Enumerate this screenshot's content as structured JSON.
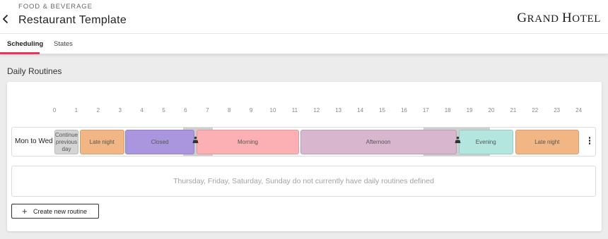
{
  "header": {
    "category": "FOOD & BEVERAGE",
    "title": "Restaurant Template",
    "logo_text": "GRAND HOTEL",
    "logo_parts": [
      "G",
      "RAND ",
      "H",
      "OTEL"
    ]
  },
  "tabs": [
    {
      "label": "Scheduling",
      "active": true
    },
    {
      "label": "States",
      "active": false
    }
  ],
  "section": {
    "title": "Daily Routines"
  },
  "timeline": {
    "hours": [
      "0",
      "1",
      "2",
      "3",
      "4",
      "5",
      "6",
      "7",
      "8",
      "9",
      "10",
      "11",
      "12",
      "13",
      "14",
      "15",
      "16",
      "17",
      "18",
      "19",
      "20",
      "21",
      "22",
      "23",
      "24"
    ]
  },
  "routine": {
    "label": "Mon to Wed",
    "segments": [
      {
        "label": "Continue previous day",
        "start": 0,
        "end": 1.1,
        "color": "#d4d4d4"
      },
      {
        "label": "Late night",
        "start": 1.15,
        "end": 3.2,
        "color": "#f1b683"
      },
      {
        "label": "Closed",
        "start": 3.25,
        "end": 6.4,
        "color": "#a996de"
      },
      {
        "label": "Morning",
        "start": 6.5,
        "end": 11.2,
        "color": "#fcb0b3"
      },
      {
        "label": "Afternoon",
        "start": 11.25,
        "end": 18.4,
        "color": "#d7b6ce"
      },
      {
        "label": "Evening",
        "start": 18.5,
        "end": 21.0,
        "color": "#b3e6df"
      },
      {
        "label": "Late night",
        "start": 21.1,
        "end": 24.0,
        "color": "#f1b683"
      }
    ],
    "transitions": [
      {
        "start": 5.9,
        "end": 7.25
      },
      {
        "start": 16.9,
        "end": 19.95
      }
    ],
    "handles_at": [
      6.45,
      18.45
    ]
  },
  "empty_state": {
    "text": "Thursday, Friday, Saturday, Sunday do not currently have daily routines defined"
  },
  "actions": {
    "create_label": "Create new routine"
  },
  "colors": {
    "accent": "#e8335a",
    "overlay": "#cfcfcf"
  }
}
